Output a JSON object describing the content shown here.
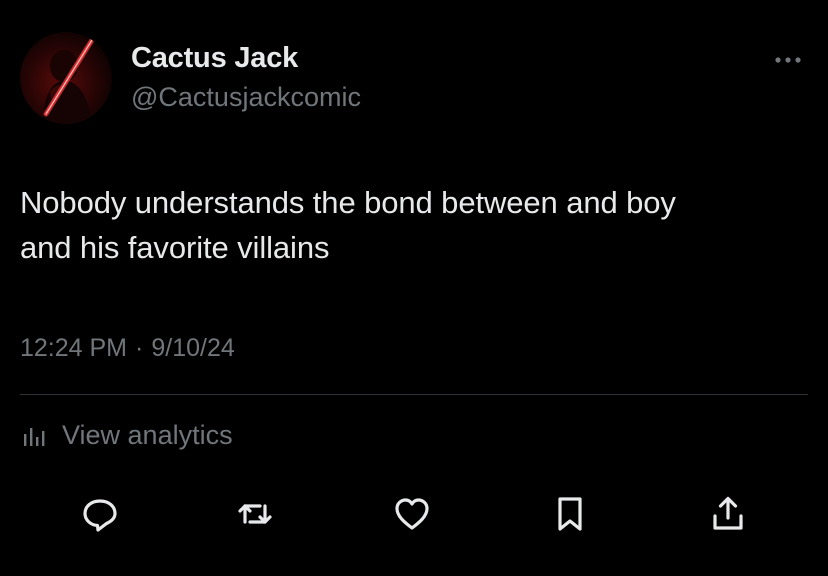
{
  "tweet": {
    "author": {
      "display_name": "Cactus Jack",
      "handle": "@Cactusjackcomic",
      "avatar_icon": "red-lightsaber-villain-avatar"
    },
    "more_icon": "more-horizontal-icon",
    "text_lines": [
      "Nobody understands the bond between and boy",
      "and his favorite villains"
    ],
    "time": "12:24 PM",
    "separator": "·",
    "date": "9/10/24",
    "analytics": {
      "icon": "bar-chart-icon",
      "label": "View analytics"
    },
    "actions": [
      {
        "name": "reply",
        "icon": "reply-icon"
      },
      {
        "name": "repost",
        "icon": "repost-icon"
      },
      {
        "name": "like",
        "icon": "heart-icon"
      },
      {
        "name": "bookmark",
        "icon": "bookmark-icon"
      },
      {
        "name": "share",
        "icon": "share-icon"
      }
    ],
    "colors": {
      "background": "#000000",
      "primary_text": "#e7e9ea",
      "secondary_text": "#71767b",
      "divider": "#2f3336",
      "icon": "#71767b",
      "lightsaber": "#ff2a2a"
    }
  }
}
